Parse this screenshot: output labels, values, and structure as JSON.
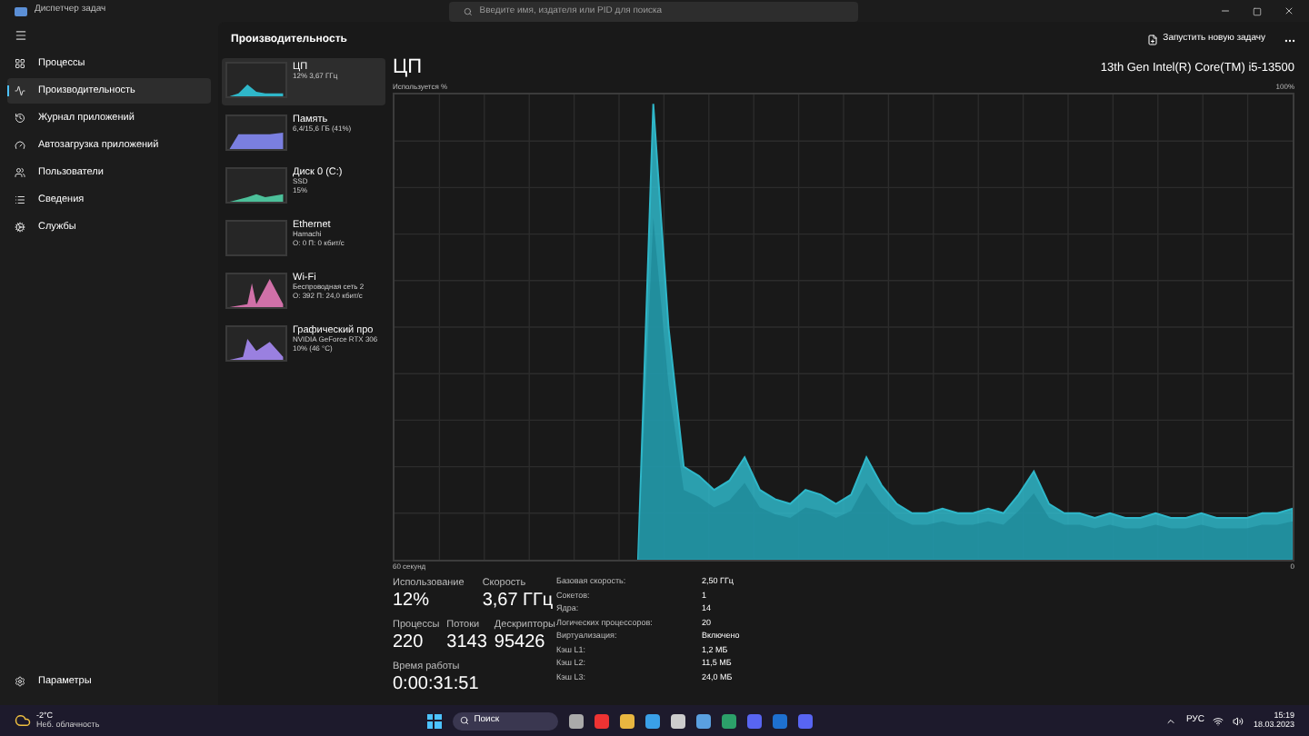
{
  "window": {
    "title": "Диспетчер задач",
    "search_placeholder": "Введите имя, издателя или PID для поиска"
  },
  "sidebar": {
    "items": [
      {
        "label": "Процессы",
        "selected": false
      },
      {
        "label": "Производительность",
        "selected": true
      },
      {
        "label": "Журнал приложений",
        "selected": false
      },
      {
        "label": "Автозагрузка приложений",
        "selected": false
      },
      {
        "label": "Пользователи",
        "selected": false
      },
      {
        "label": "Сведения",
        "selected": false
      },
      {
        "label": "Службы",
        "selected": false
      }
    ],
    "settings": "Параметры"
  },
  "header": {
    "title": "Производительность",
    "new_task": "Запустить новую задачу"
  },
  "devices": [
    {
      "name": "ЦП",
      "lines": [
        "12% 3,67 ГГц"
      ],
      "color": "#2fb7c9",
      "selected": true
    },
    {
      "name": "Память",
      "lines": [
        "6,4/15,6 ГБ (41%)"
      ],
      "color": "#7a7fe0",
      "selected": false
    },
    {
      "name": "Диск 0 (C:)",
      "lines": [
        "SSD",
        "15%"
      ],
      "color": "#4cc09a",
      "selected": false
    },
    {
      "name": "Ethernet",
      "lines": [
        "Hamachi",
        "О: 0 П: 0 кбит/с"
      ],
      "selected": false
    },
    {
      "name": "Wi-Fi",
      "lines": [
        "Беспроводная сеть 2",
        "О: 392 П: 24,0 кбит/с"
      ],
      "color": "#d070a8",
      "selected": false
    },
    {
      "name": "Графический про",
      "lines": [
        "NVIDIA GeForce RTX 306",
        "10% (46 °C)"
      ],
      "color": "#9a80e0",
      "selected": false
    }
  ],
  "cpu": {
    "title": "ЦП",
    "model": "13th Gen Intel(R) Core(TM) i5-13500",
    "graph_label": "Используется %",
    "graph_max": "100%",
    "graph_span": "60 секунд",
    "graph_min": "0"
  },
  "stats": {
    "main": [
      {
        "label": "Использование",
        "value": "12%"
      },
      {
        "label": "Скорость",
        "value": "3,67 ГГц"
      },
      {
        "label": "Процессы",
        "value": "220"
      },
      {
        "label": "Потоки",
        "value": "3143"
      },
      {
        "label": "Дескрипторы",
        "value": "95426"
      },
      {
        "label": "Время работы",
        "value": "0:00:31:51"
      }
    ],
    "info": [
      {
        "label": "Базовая скорость:",
        "value": "2,50 ГГц"
      },
      {
        "label": "Сокетов:",
        "value": "1"
      },
      {
        "label": "Ядра:",
        "value": "14"
      },
      {
        "label": "Логических процессоров:",
        "value": "20"
      },
      {
        "label": "Виртуализация:",
        "value": "Включено"
      },
      {
        "label": "Кэш L1:",
        "value": "1,2 МБ"
      },
      {
        "label": "Кэш L2:",
        "value": "11,5 МБ"
      },
      {
        "label": "Кэш L3:",
        "value": "24,0 МБ"
      }
    ]
  },
  "taskbar": {
    "temperature": "-2°C",
    "weather": "Неб. облачность",
    "search": "Поиск",
    "language": "РУС",
    "time": "15:19",
    "date": "18.03.2023"
  }
}
